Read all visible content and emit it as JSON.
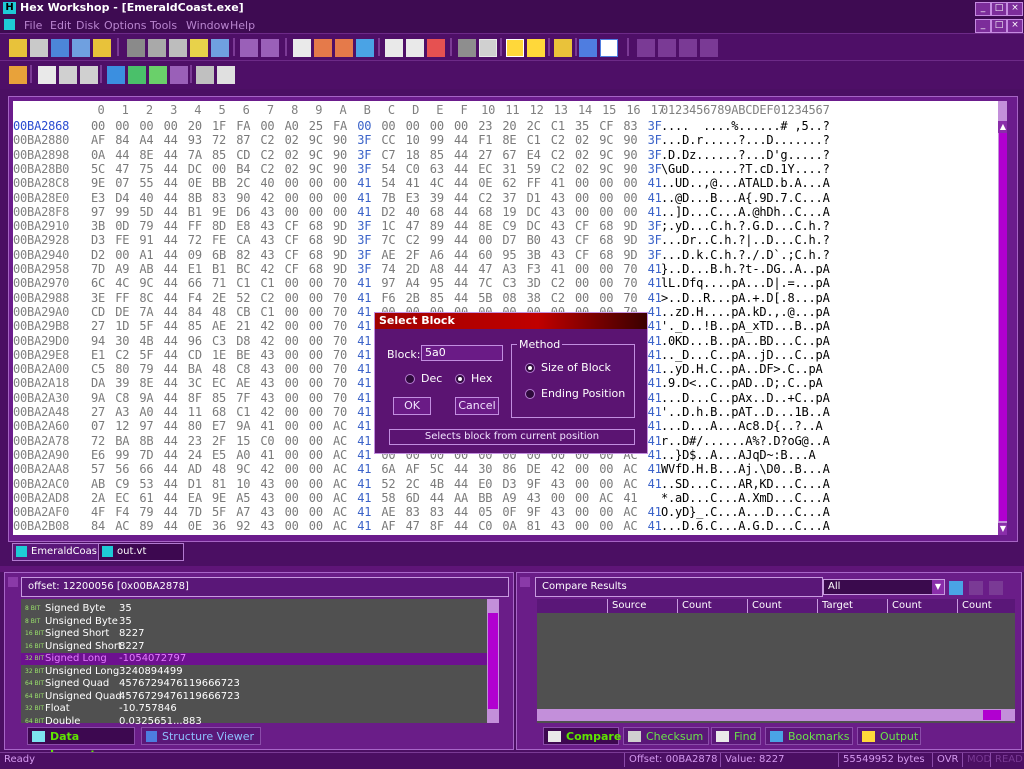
{
  "window": {
    "title": "Hex Workshop - [EmeraldCoast.exe]"
  },
  "menubar": {
    "items": [
      "File",
      "Edit",
      "Disk",
      "Options",
      "Tools",
      "Window",
      "Help"
    ]
  },
  "hex": {
    "header_cols": [
      "0",
      "1",
      "2",
      "3",
      "4",
      "5",
      "6",
      "7",
      "8",
      "9",
      "A",
      "B",
      "C",
      "D",
      "E",
      "F",
      "10",
      "11",
      "12",
      "13",
      "14",
      "15",
      "16",
      "17"
    ],
    "ascii_header": "0123456789ABCDEF01234567",
    "rows": [
      {
        "off": "00BA2868",
        "bytes": "00 00 00 00 20 1F FA 00 A0 25 FA 00 00 00 00 00 23 20 2C C1 35 CF 83 3F",
        "ascii": "....  ....%......# ,5..?"
      },
      {
        "off": "00BA2880",
        "bytes": "AF 84 A4 44 93 72 87 C2 02 9C 90 3F CC 10 99 44 F1 8E C1 C2 02 9C 90 3F",
        "ascii": "...D.r.....?...D.......?"
      },
      {
        "off": "00BA2898",
        "bytes": "0A 44 8E 44 7A 85 CD C2 02 9C 90 3F C7 18 85 44 27 67 E4 C2 02 9C 90 3F",
        "ascii": ".D.Dz......?...D'g.....?"
      },
      {
        "off": "00BA28B0",
        "bytes": "5C 47 75 44 DC 00 B4 C2 02 9C 90 3F 54 C0 63 44 EC 31 59 C2 02 9C 90 3F",
        "ascii": "\\GuD.......?T.cD.1Y....?"
      },
      {
        "off": "00BA28C8",
        "bytes": "9E 07 55 44 0E BB 2C 40 00 00 00 41 54 41 4C 44 0E 62 FF 41 00 00 00 41",
        "ascii": "..UD..,@...ATALD.b.A...A"
      },
      {
        "off": "00BA28E0",
        "bytes": "E3 D4 40 44 8B 83 90 42 00 00 00 41 7B E3 39 44 C2 37 D1 43 00 00 00 41",
        "ascii": "..@D...B...A{.9D.7.C...A"
      },
      {
        "off": "00BA28F8",
        "bytes": "97 99 5D 44 B1 9E D6 43 00 00 00 41 D2 40 68 44 68 19 DC 43 00 00 00 41",
        "ascii": "..]D...C...A.@hDh..C...A"
      },
      {
        "off": "00BA2910",
        "bytes": "3B 0D 79 44 FF 8D E8 43 CF 68 9D 3F 1C 47 89 44 8E C9 DC 43 CF 68 9D 3F",
        "ascii": ";.yD...C.h.?.G.D...C.h.?"
      },
      {
        "off": "00BA2928",
        "bytes": "D3 FE 91 44 72 FE CA 43 CF 68 9D 3F 7C C2 99 44 00 D7 B0 43 CF 68 9D 3F",
        "ascii": "...Dr..C.h.?|..D...C.h.?"
      },
      {
        "off": "00BA2940",
        "bytes": "D2 00 A1 44 09 6B 82 43 CF 68 9D 3F AE 2F A6 44 60 95 3B 43 CF 68 9D 3F",
        "ascii": "...D.k.C.h.?./.D`.;C.h.?"
      },
      {
        "off": "00BA2958",
        "bytes": "7D A9 AB 44 E1 B1 BC 42 CF 68 9D 3F 74 2D A8 44 47 A3 F3 41 00 00 70 41",
        "ascii": "}..D...B.h.?t-.DG..A..pA"
      },
      {
        "off": "00BA2970",
        "bytes": "6C 4C 9C 44 66 71 C1 C1 00 00 70 41 97 A4 95 44 7C C3 3D C2 00 00 70 41",
        "ascii": "lL.Dfq....pA...D|.=...pA"
      },
      {
        "off": "00BA2988",
        "bytes": "3E FF 8C 44 F4 2E 52 C2 00 00 70 41 F6 2B 85 44 5B 08 38 C2 00 00 70 41",
        "ascii": ">..D..R...pA.+.D[.8...pA"
      },
      {
        "off": "00BA29A0",
        "bytes": "CD DE 7A 44 84 48 CB C1 00 00 70 41 00 00 00 00 00 00 00 00 00 00 70 41",
        "ascii": "..zD.H....pA.kD.,.@...pA"
      },
      {
        "off": "00BA29B8",
        "bytes": "27 1D 5F 44 85 AE 21 42 00 00 70 41 00 00 00 00 00 00 00 00 00 00 70 41",
        "ascii": "'._D..!B..pA_xTD...B..pA"
      },
      {
        "off": "00BA29D0",
        "bytes": "94 30 4B 44 96 C3 D8 42 00 00 70 41 00 00 00 00 00 00 00 00 00 00 70 41",
        "ascii": ".0KD...B..pA..BD...C..pA"
      },
      {
        "off": "00BA29E8",
        "bytes": "E1 C2 5F 44 CD 1E BE 43 00 00 70 41 00 00 00 00 00 00 00 00 00 00 70 41",
        "ascii": ".._D...C..pA..jD...C..pA"
      },
      {
        "off": "00BA2A00",
        "bytes": "C5 80 79 44 BA 48 C8 43 00 00 70 41 00 00 00 00 00 00 00 00 00 00 70 41",
        "ascii": "..yD.H.C..pA..DF>.C..pA"
      },
      {
        "off": "00BA2A18",
        "bytes": "DA 39 8E 44 3C EC AE 43 00 00 70 41 00 00 00 00 00 00 00 00 00 00 70 41",
        "ascii": ".9.D<..C..pAD..D;.C..pA"
      },
      {
        "off": "00BA2A30",
        "bytes": "9A C8 9A 44 8F 85 7F 43 00 00 70 41 00 00 00 00 00 00 00 00 00 00 70 41",
        "ascii": "...D...C..pAx..D..+C..pA"
      },
      {
        "off": "00BA2A48",
        "bytes": "27 A3 A0 44 11 68 C1 42 00 00 70 41 00 00 00 00 00 00 00 00 00 00 70 41",
        "ascii": "'..D.h.B..pAT..D...1B..A"
      },
      {
        "off": "00BA2A60",
        "bytes": "07 12 97 44 80 E7 9A 41 00 00 AC 41 00 00 00 00 00 00 00 00 00 00 AC 41",
        "ascii": "...D...A...Ac8.D{..?..A"
      },
      {
        "off": "00BA2A78",
        "bytes": "72 BA 8B 44 23 2F 15 C0 00 00 AC 41 00 00 00 00 00 00 00 00 00 00 AC 41",
        "ascii": "r..D#/......A%?.D?oG@..A"
      },
      {
        "off": "00BA2A90",
        "bytes": "E6 99 7D 44 24 E5 A0 41 00 00 AC 41 00 00 00 00 00 00 00 00 00 00 AC 41",
        "ascii": "..}D$..A...AJqD~:B...A"
      },
      {
        "off": "00BA2AA8",
        "bytes": "57 56 66 44 AD 48 9C 42 00 00 AC 41 6A AF 5C 44 30 86 DE 42 00 00 AC 41",
        "ascii": "WVfD.H.B...Aj.\\D0..B...A"
      },
      {
        "off": "00BA2AC0",
        "bytes": "AB C9 53 44 D1 81 10 43 00 00 AC 41 52 2C 4B 44 E0 D3 9F 43 00 00 AC 41",
        "ascii": "..SD...C...AR,KD...C...A"
      },
      {
        "off": "00BA2AD8",
        "bytes": "2A EC 61 44 EA 9E A5 43 00 00 AC 41 58 6D 44 AA BB A9 43 00 00 AC 41",
        "ascii": "*.aD...C...A.XmD...C...A"
      },
      {
        "off": "00BA2AF0",
        "bytes": "4F F4 79 44 7D 5F A7 43 00 00 AC 41 AE 83 83 44 05 0F 9F 43 00 00 AC 41",
        "ascii": "O.yD}_.C...A...D...C...A"
      },
      {
        "off": "00BA2B08",
        "bytes": "84 AC 89 44 0E 36 92 43 00 00 AC 41 AF 47 8F 44 C0 0A 81 43 00 00 AC 41",
        "ascii": "...D.6.C...A.G.D...C...A"
      }
    ]
  },
  "doc_tabs": [
    "EmeraldCoas...",
    "out.vt"
  ],
  "inspector": {
    "header": "offset: 12200056 [0x00BA2878]",
    "rows": [
      {
        "bits": "8 BIT",
        "label": "Signed Byte",
        "value": "35"
      },
      {
        "bits": "8 BIT",
        "label": "Unsigned Byte",
        "value": "35"
      },
      {
        "bits": "16 BIT",
        "label": "Signed Short",
        "value": "8227"
      },
      {
        "bits": "16 BIT",
        "label": "Unsigned Short",
        "value": "8227"
      },
      {
        "bits": "32 BIT",
        "label": "Signed Long",
        "value": "-1054072797"
      },
      {
        "bits": "32 BIT",
        "label": "Unsigned Long",
        "value": "3240894499"
      },
      {
        "bits": "64 BIT",
        "label": "Signed Quad",
        "value": "4576729476119666723"
      },
      {
        "bits": "64 BIT",
        "label": "Unsigned Quad",
        "value": "4576729476119666723"
      },
      {
        "bits": "32 BIT",
        "label": "Float",
        "value": "-10.757846"
      },
      {
        "bits": "64 BIT",
        "label": "Double",
        "value": "0.0325651...883"
      }
    ],
    "tabs": [
      "Data Inspector",
      "Structure Viewer"
    ]
  },
  "compare": {
    "header": "Compare Results",
    "filter": "All",
    "columns": [
      "Source",
      "Count",
      "Count",
      "Target",
      "Count",
      "Count"
    ],
    "tabs": [
      "Compare",
      "Checksum",
      "Find",
      "Bookmarks",
      "Output"
    ]
  },
  "status": {
    "ready": "Ready",
    "offset": "Offset: 00BA2878",
    "value": "Value: 8227",
    "size": "55549952 bytes",
    "ovr": "OVR",
    "mod": "MOD",
    "read": "READ"
  },
  "dialog": {
    "title": "Select Block",
    "block_label": "Block:",
    "block_value": "5a0",
    "dec_label": "Dec",
    "hex_label": "Hex",
    "method_label": "Method",
    "size_label": "Size of Block",
    "end_label": "Ending Position",
    "ok_label": "OK",
    "cancel_label": "Cancel",
    "hint": "Selects block from current position"
  }
}
